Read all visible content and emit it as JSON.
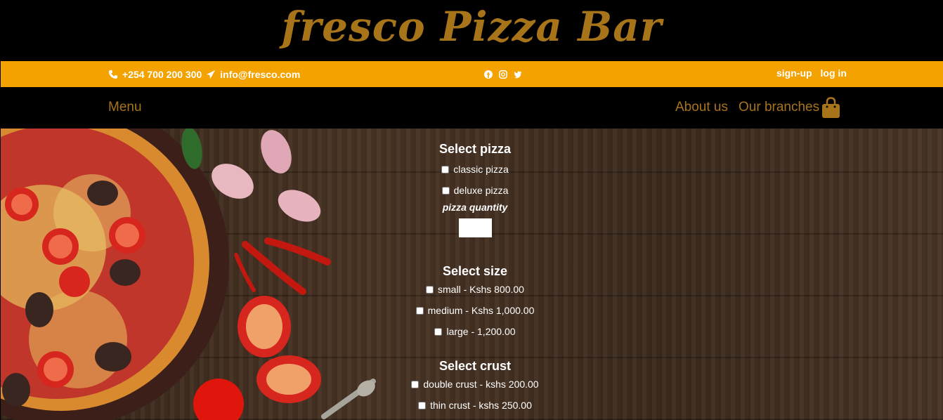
{
  "brand": {
    "title": "fresco Pizza Bar"
  },
  "info_bar": {
    "phone": "+254 700 200 300",
    "email": "info@fresco.com",
    "signup": "sign-up",
    "login": "log in"
  },
  "nav": {
    "menu": "Menu",
    "about": "About us",
    "branches": "Our branches"
  },
  "form": {
    "pizza_title": "Select pizza",
    "pizza_options": [
      "classic pizza",
      "deluxe pizza"
    ],
    "quantity_label": "pizza quantity",
    "quantity_value": "",
    "size_title": "Select size",
    "size_options": [
      "small - Kshs 800.00",
      "medium - Kshs 1,000.00",
      "large - 1,200.00"
    ],
    "crust_title": "Select crust",
    "crust_options": [
      "double crust - kshs 200.00",
      "thin crust - kshs 250.00"
    ]
  },
  "colors": {
    "brand_gold": "#a8741a",
    "info_orange": "#f4a200",
    "bar_black": "#000000"
  }
}
